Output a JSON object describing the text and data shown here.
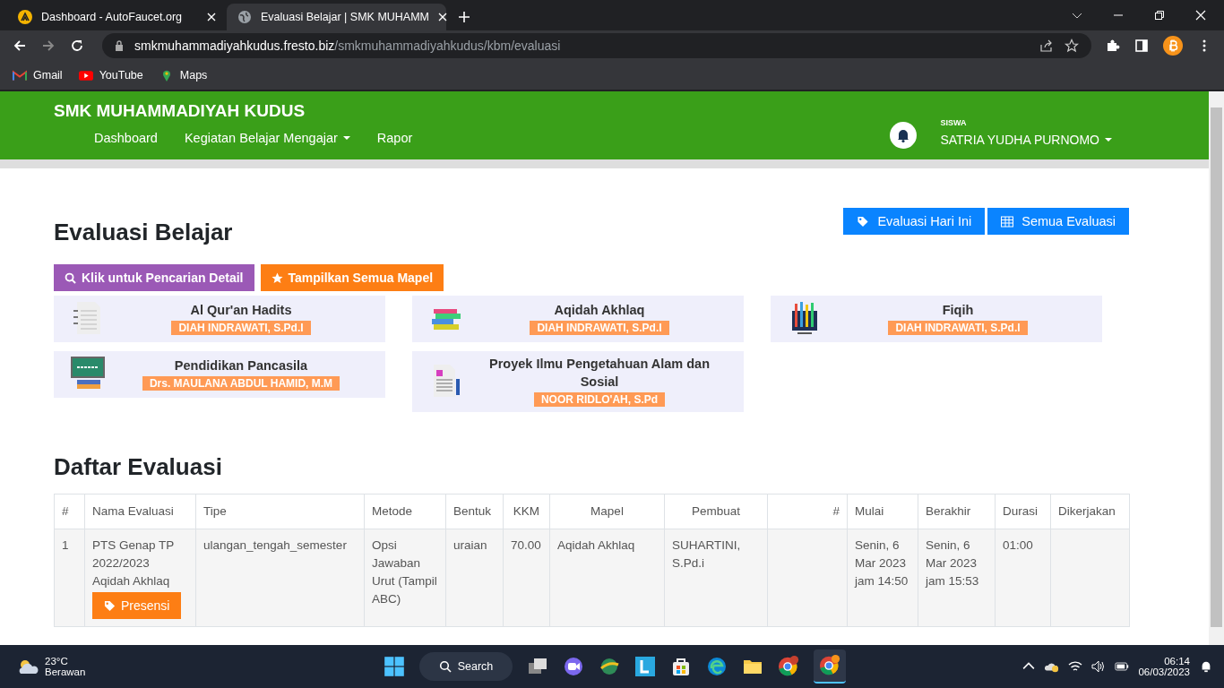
{
  "browser": {
    "tabs": [
      {
        "title": "Dashboard - AutoFaucet.org",
        "selected": false
      },
      {
        "title": "Evaluasi Belajar | SMK MUHAMM",
        "selected": true
      }
    ],
    "url_host": "smkmuhammadiyahkudus.fresto.biz",
    "url_path": "/smkmuhammadiyahkudus/kbm/evaluasi",
    "bookmarks": [
      {
        "label": "Gmail"
      },
      {
        "label": "YouTube"
      },
      {
        "label": "Maps"
      }
    ]
  },
  "site": {
    "title": "SMK MUHAMMADIYAH KUDUS",
    "nav": [
      {
        "label": "Dashboard",
        "dropdown": false
      },
      {
        "label": "Kegiatan Belajar Mengajar",
        "dropdown": true
      },
      {
        "label": "Rapor",
        "dropdown": false
      }
    ],
    "user_role": "SISWA",
    "user_name": "SATRIA YUDHA PURNOMO"
  },
  "page_title": "Evaluasi Belajar",
  "top_buttons": [
    {
      "label": "Evaluasi Hari Ini"
    },
    {
      "label": "Semua Evaluasi"
    }
  ],
  "filter_buttons": [
    {
      "label": "Klik untuk Pencarian Detail",
      "color": "#9b59b6"
    },
    {
      "label": "Tampilkan Semua Mapel",
      "color": "#fd7e14"
    }
  ],
  "subjects": [
    {
      "name": "Al Qur'an Hadits",
      "teacher": "DIAH INDRAWATI, S.Pd.I"
    },
    {
      "name": "Aqidah Akhlaq",
      "teacher": "DIAH INDRAWATI, S.Pd.I"
    },
    {
      "name": "Fiqih",
      "teacher": "DIAH INDRAWATI, S.Pd.I"
    },
    {
      "name": "Pendidikan Pancasila",
      "teacher": "Drs. MAULANA ABDUL HAMID, M.M"
    },
    {
      "name": "Proyek Ilmu Pengetahuan Alam dan Sosial",
      "teacher": "NOOR RIDLO'AH, S.Pd"
    }
  ],
  "list_title": "Daftar Evaluasi",
  "table": {
    "columns": [
      "#",
      "Nama Evaluasi",
      "Tipe",
      "Metode",
      "Bentuk",
      "KKM",
      "Mapel",
      "Pembuat",
      "#",
      "Mulai",
      "Berakhir",
      "Durasi",
      "Dikerjakan"
    ],
    "rows": [
      {
        "no": "1",
        "name": "PTS Genap TP 2022/2023 Aqidah Akhlaq",
        "action": "Presensi",
        "tipe": "ulangan_tengah_semester",
        "metode": "Opsi Jawaban Urut (Tampil ABC)",
        "bentuk": "uraian",
        "kkm": "70.00",
        "mapel": "Aqidah Akhlaq",
        "pembuat": "SUHARTINI, S.Pd.i",
        "mulai": "Senin, 6 Mar 2023 jam 14:50",
        "berakhir": "Senin, 6 Mar 2023 jam 15:53",
        "durasi": "01:00"
      }
    ]
  },
  "taskbar": {
    "temperature": "23°C",
    "weather": "Berawan",
    "search": "Search",
    "time": "06:14",
    "date": "06/03/2023"
  }
}
